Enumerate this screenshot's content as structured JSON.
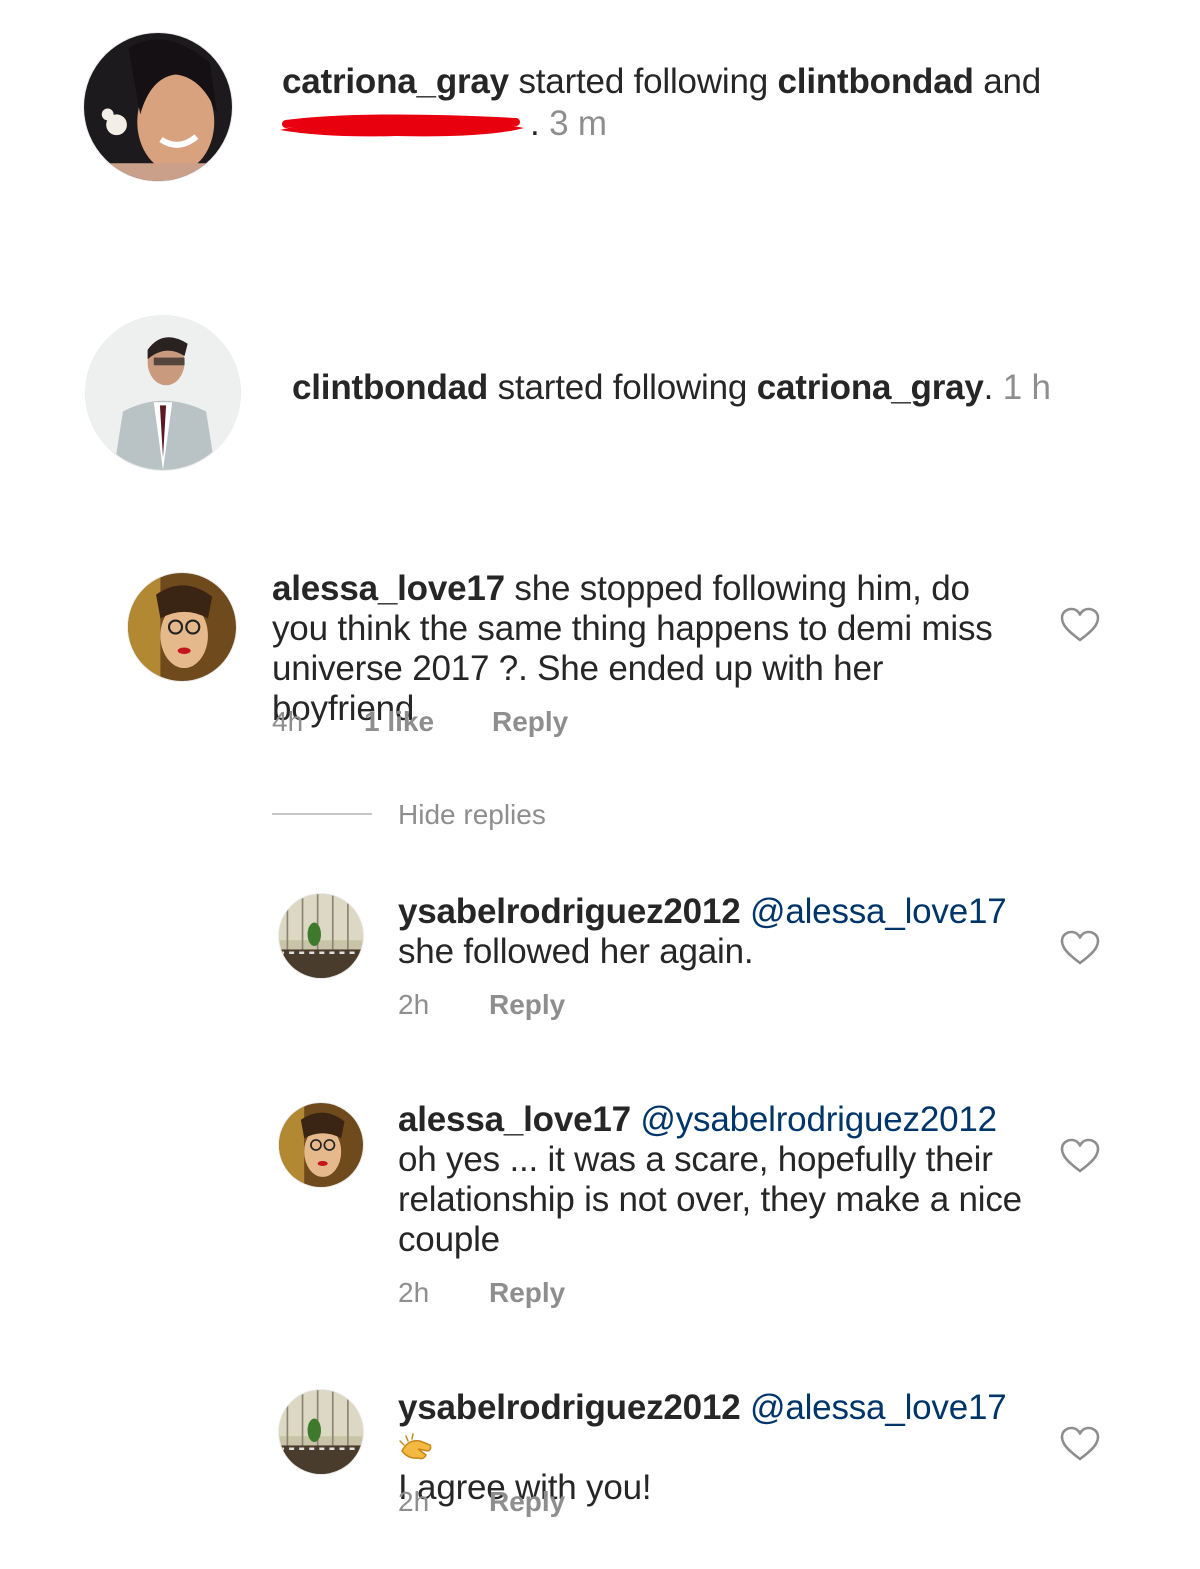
{
  "notifications": [
    {
      "user": "catriona_gray",
      "action": "started following",
      "target": "clintbondad",
      "conj": "and",
      "redacted_suffix": ".",
      "time": "3 m"
    },
    {
      "user": "clintbondad",
      "action": "started following",
      "target": "catriona_gray",
      "suffix": ".",
      "time": "1 h"
    }
  ],
  "comment": {
    "user": "alessa_love17",
    "lines": [
      "she stopped following him, do",
      "you think the same thing happens to demi miss",
      "universe 2017 ?. She ended up with her boyfriend"
    ],
    "time": "4h",
    "likes": "1 like",
    "reply_label": "Reply",
    "hide_replies": "Hide replies"
  },
  "replies": [
    {
      "user": "ysabelrodriguez2012",
      "mention": "@alessa_love17",
      "lines": [
        "she followed her again."
      ],
      "time": "2h",
      "reply_label": "Reply"
    },
    {
      "user": "alessa_love17",
      "mention": "@ysabelrodriguez2012",
      "lines": [
        "oh yes ... it was a scare, hopefully their",
        "relationship is not over, they make a nice",
        "couple"
      ],
      "time": "2h",
      "reply_label": "Reply"
    },
    {
      "user": "ysabelrodriguez2012",
      "mention": "@alessa_love17",
      "emoji": "clapping-hands-icon",
      "lines": [
        "I agree with you!"
      ],
      "time": "2h",
      "reply_label": "Reply"
    }
  ],
  "colors": {
    "text": "#262626",
    "meta": "#8e8e8e",
    "mention": "#003569",
    "redaction": "#e8000f",
    "divider": "#c7c7c7"
  }
}
